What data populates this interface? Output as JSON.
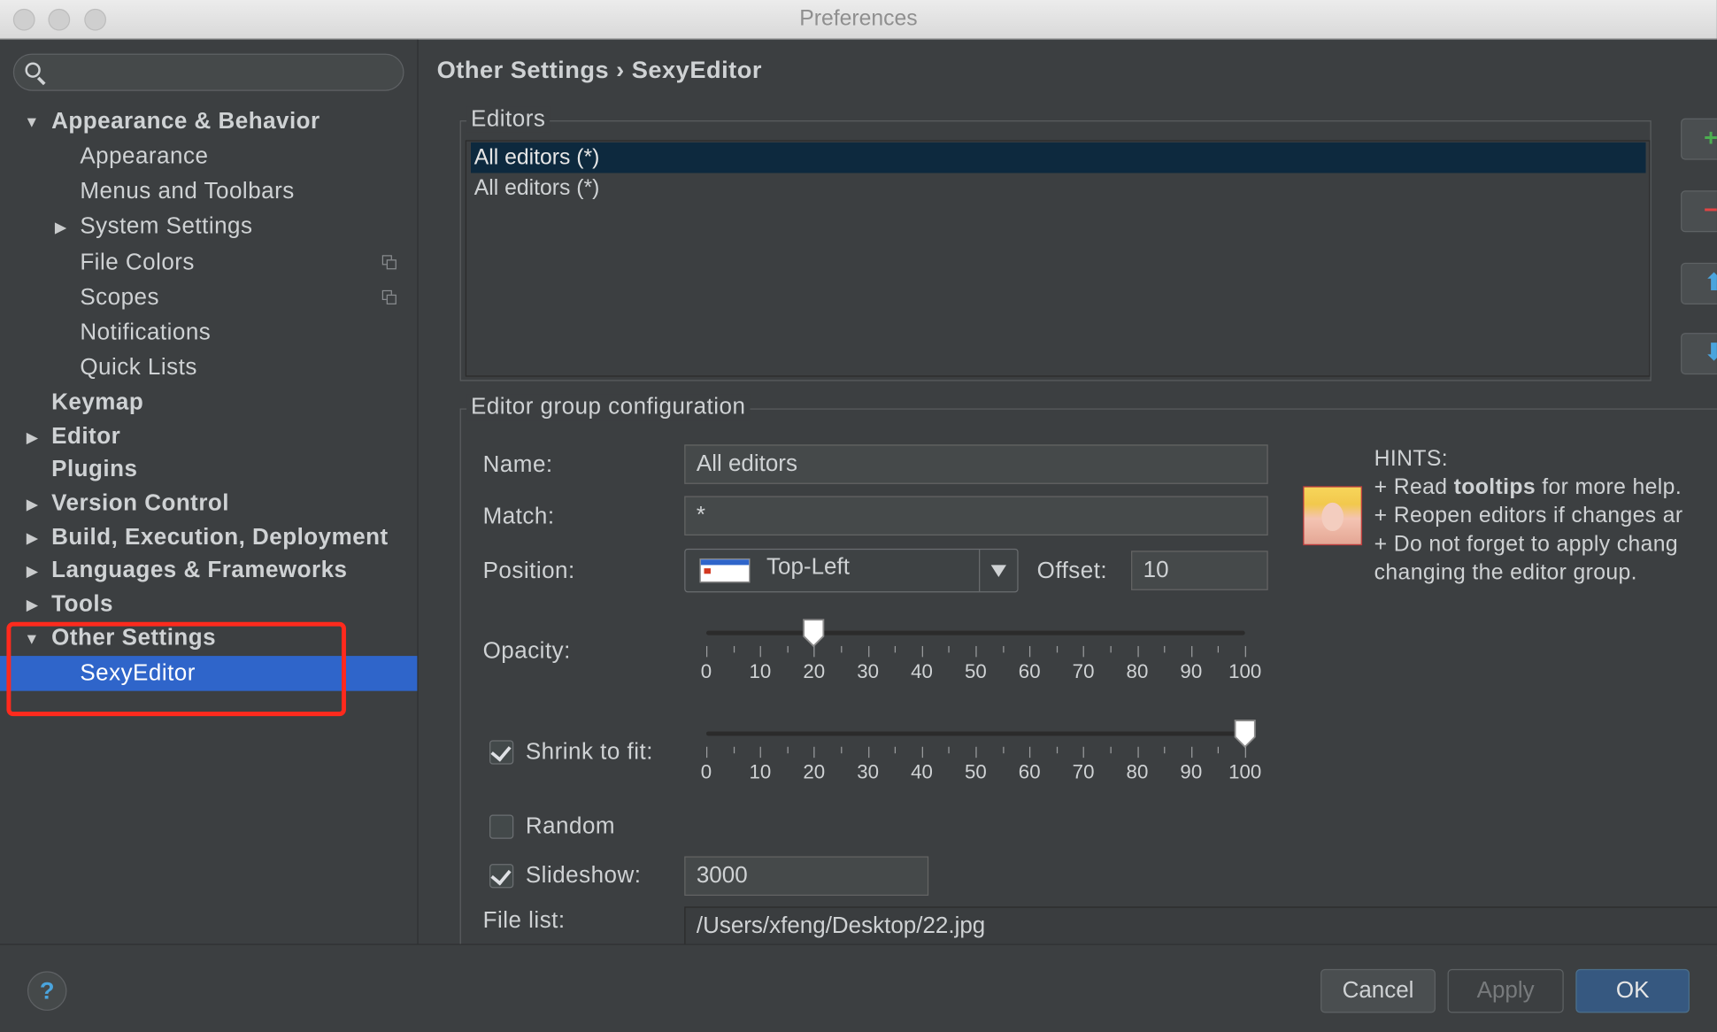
{
  "window": {
    "title": "Preferences"
  },
  "sidebar": {
    "search_placeholder": "",
    "items": [
      {
        "label": "Appearance & Behavior",
        "bold": true,
        "expanded": true
      },
      {
        "label": "Appearance"
      },
      {
        "label": "Menus and Toolbars"
      },
      {
        "label": "System Settings",
        "collapsed": true
      },
      {
        "label": "File Colors",
        "icon": "copy-icon"
      },
      {
        "label": "Scopes",
        "icon": "copy-icon"
      },
      {
        "label": "Notifications"
      },
      {
        "label": "Quick Lists"
      },
      {
        "label": "Keymap",
        "bold": true
      },
      {
        "label": "Editor",
        "bold": true,
        "collapsed": true
      },
      {
        "label": "Plugins",
        "bold": true
      },
      {
        "label": "Version Control",
        "bold": true,
        "collapsed": true
      },
      {
        "label": "Build, Execution, Deployment",
        "bold": true,
        "collapsed": true
      },
      {
        "label": "Languages & Frameworks",
        "bold": true,
        "collapsed": true
      },
      {
        "label": "Tools",
        "bold": true,
        "collapsed": true
      },
      {
        "label": "Other Settings",
        "bold": true,
        "expanded": true
      },
      {
        "label": "SexyEditor",
        "selected": true
      }
    ]
  },
  "main": {
    "breadcrumb": "Other Settings › SexyEditor",
    "editors": {
      "legend": "Editors",
      "items": [
        "All editors (*)",
        "All editors (*)"
      ],
      "buttons": {
        "add": "+",
        "remove": "−",
        "up": "⬆",
        "down": "⬇"
      }
    },
    "group": {
      "legend": "Editor group configuration",
      "name_label": "Name:",
      "name_value": "All editors",
      "match_label": "Match:",
      "match_value": "*",
      "position_label": "Position:",
      "position_value": "Top-Left",
      "offset_label": "Offset:",
      "offset_value": "10",
      "opacity_label": "Opacity:",
      "opacity_value": 20,
      "slider_ticks": [
        "0",
        "10",
        "20",
        "30",
        "40",
        "50",
        "60",
        "70",
        "80",
        "90",
        "100"
      ],
      "shrink_label": "Shrink to fit:",
      "shrink_checked": true,
      "shrink_value": 100,
      "random_label": "Random",
      "random_checked": false,
      "slideshow_label": "Slideshow:",
      "slideshow_checked": true,
      "slideshow_value": "3000",
      "filelist_label": "File list:",
      "filelist_value": "/Users/xfeng/Desktop/22.jpg"
    },
    "hints": {
      "title": "HINTS:",
      "line1_prefix": "+ Read ",
      "line1_bold": "tooltips",
      "line1_suffix": " for more help.",
      "line2": "+ Reopen editors if changes ar",
      "line3": "+ Do not forget to apply chang",
      "line4": "changing the editor group."
    }
  },
  "footer": {
    "help": "?",
    "cancel": "Cancel",
    "apply": "Apply",
    "ok": "OK"
  },
  "colors": {
    "selection": "#2f65ca",
    "annotation": "#ff2a1d",
    "add": "#4caf50",
    "remove": "#e04444",
    "arrows": "#4aa4dd"
  }
}
